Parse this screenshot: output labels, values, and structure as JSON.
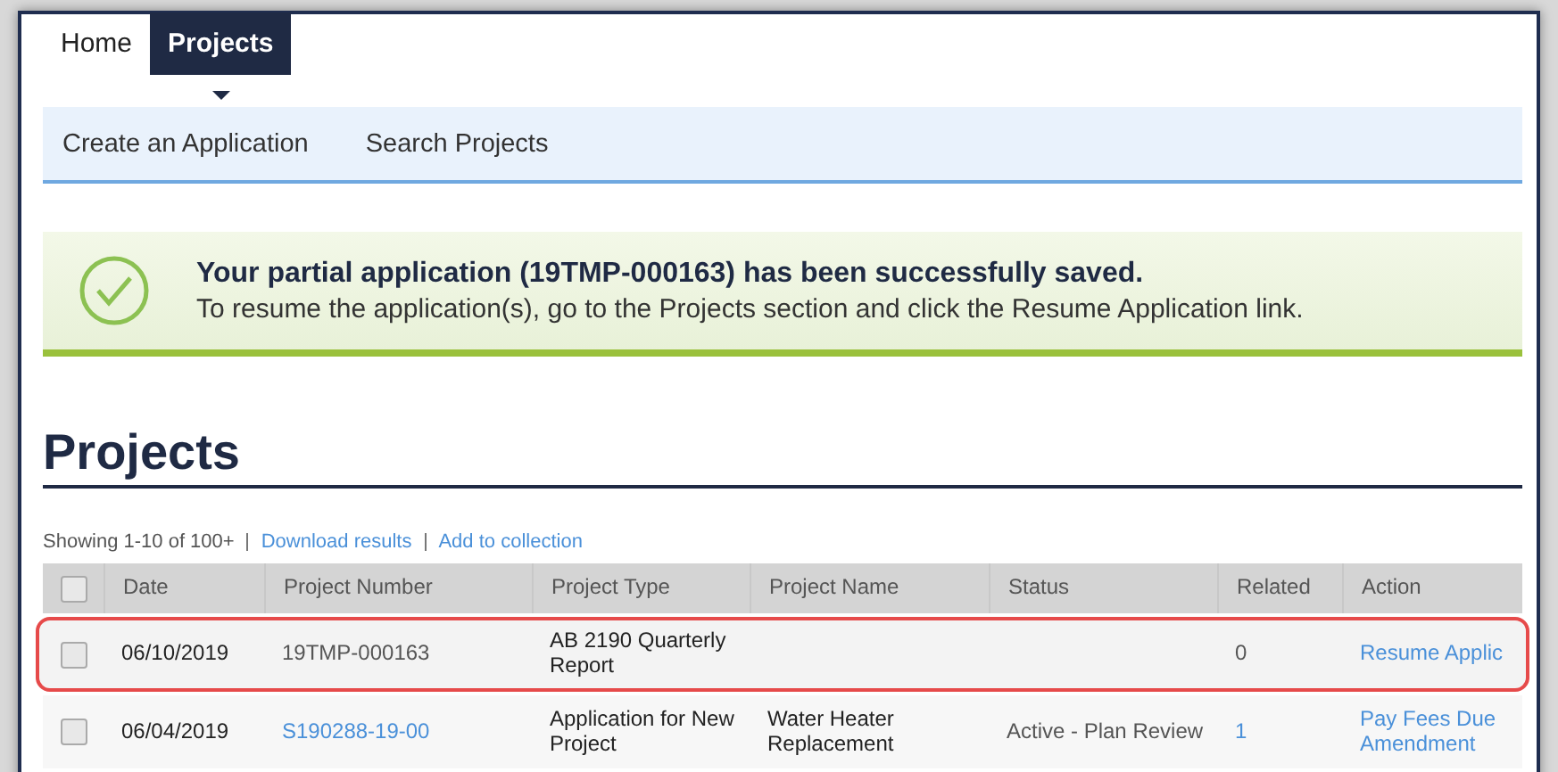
{
  "nav": {
    "tabs": [
      {
        "label": "Home",
        "selected": false
      },
      {
        "label": "Projects",
        "selected": true
      }
    ]
  },
  "subnav": {
    "items": [
      "Create an Application",
      "Search Projects"
    ]
  },
  "banner": {
    "title": "Your partial application (19TMP-000163) has been successfully saved.",
    "message": "To resume the application(s), go to the Projects section and click the Resume Application link."
  },
  "heading": "Projects",
  "results": {
    "summary": "Showing 1-10 of 100+",
    "links": [
      "Download results",
      "Add to collection"
    ]
  },
  "table": {
    "select_all_checked": false,
    "columns": [
      "Date",
      "Project Number",
      "Project Type",
      "Project Name",
      "Status",
      "Related",
      "Action"
    ],
    "rows": [
      {
        "highlighted": true,
        "checked": false,
        "date": "06/10/2019",
        "number": "19TMP-000163",
        "number_link": false,
        "type": "AB 2190 Quarterly Report",
        "related": "0",
        "related_link": false,
        "action": "Resume Applic"
      },
      {
        "highlighted": false,
        "checked": false,
        "date": "06/04/2019",
        "number": "S190288-19-00",
        "number_link": true,
        "type": "Application for New Project",
        "name": "Water Heater Replacement",
        "status": "Active - Plan Review",
        "related": "1",
        "related_link": true,
        "action": "Pay Fees Due Amendment"
      }
    ]
  }
}
